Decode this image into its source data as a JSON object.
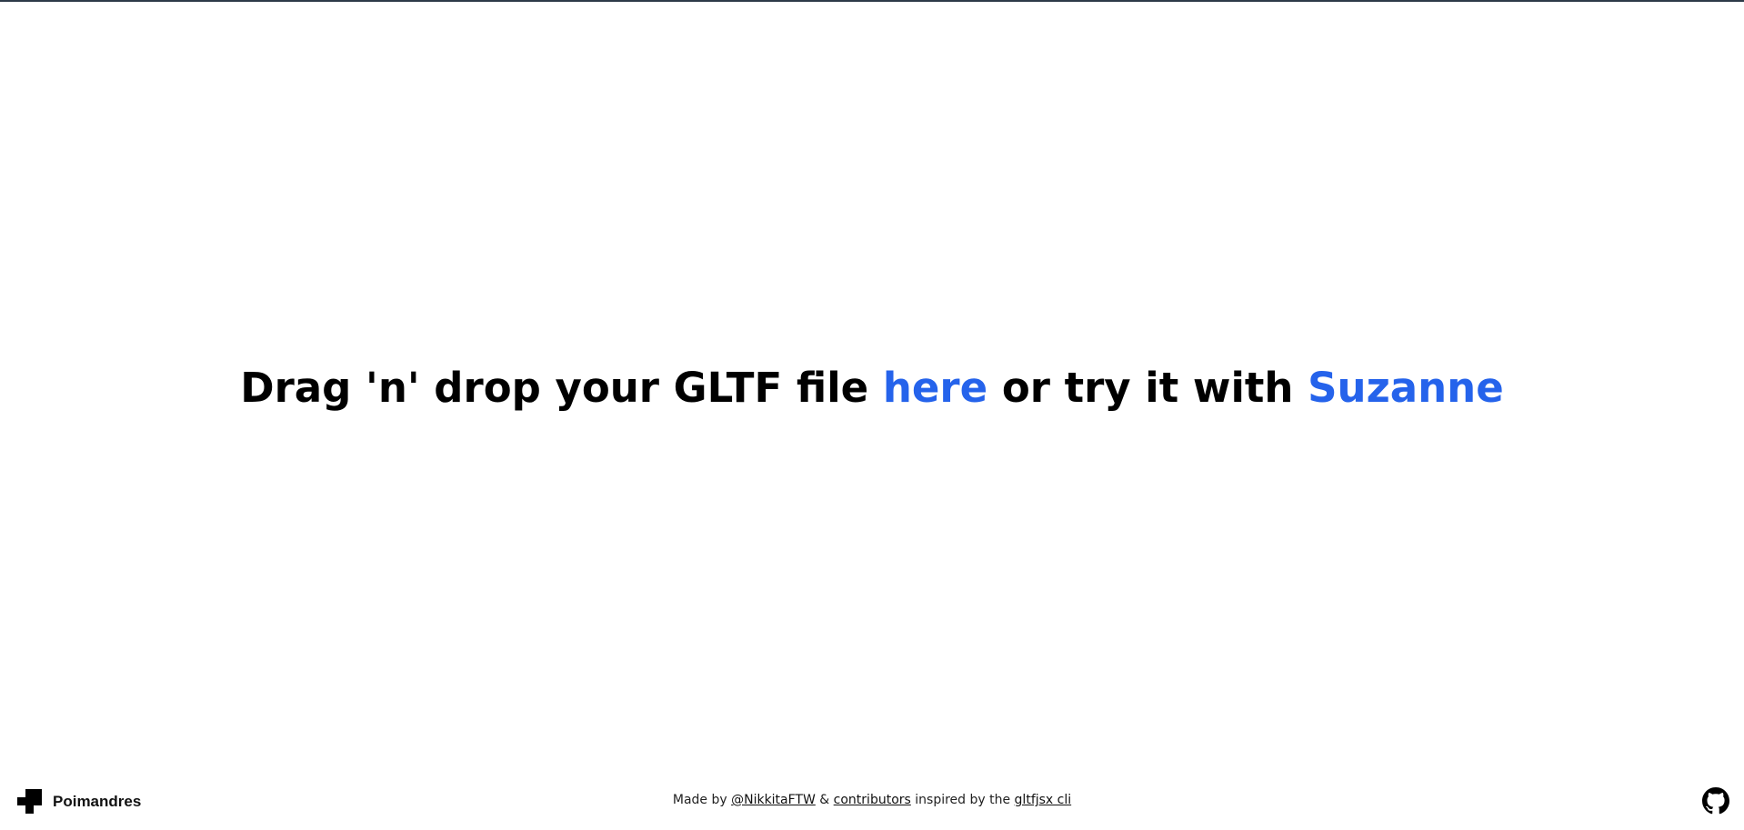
{
  "hero": {
    "prefix": "Drag 'n' drop your GLTF file ",
    "here_link": "here",
    "middle": " or try it with ",
    "suzanne_link": "Suzanne"
  },
  "footer": {
    "brand_name": "Poimandres",
    "brand_icon": "poimandres-logo-icon",
    "made_by": "Made by ",
    "author_link": "@NikkitaFTW",
    "amp": " & ",
    "contributors_link": "contributors",
    "inspired": " inspired by the ",
    "cli_link": "gltfjsx cli",
    "github_icon": "github-icon"
  },
  "colors": {
    "accent": "#2563eb",
    "top_border": "#2d3a48"
  }
}
